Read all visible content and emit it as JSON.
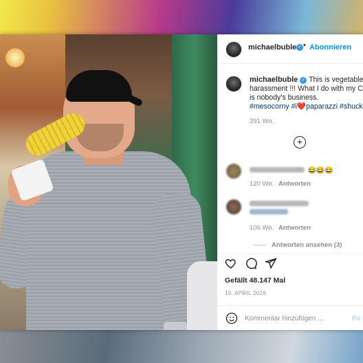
{
  "post": {
    "username": "michaelbuble",
    "follow_label": "Abonnieren",
    "caption_line1": "This is vegetable",
    "caption_line2": "harassment !!! What I do with my Co",
    "caption_line3": "is nobody's business.",
    "hashtag1": "#mesocorny",
    "hashtag2": "#i",
    "heart": "❤️",
    "hashtag3": "paparazzi",
    "hashtag4": "#shuck",
    "caption_age": "291 Wo.",
    "add_comments_icon": "plus-circle-icon",
    "comments": [
      {
        "emojis": "😂😂😂",
        "age": "120 Wo.",
        "reply": "Antworten"
      },
      {
        "age": "106 Wo.",
        "reply": "Antworten"
      }
    ],
    "view_replies": "Antworten ansehen (3)",
    "likes": "Gefällt 48.147 Mal",
    "date": "15. APRIL 2016",
    "comment_placeholder": "Kommentar hinzufügen ...",
    "post_label": "Po",
    "verified_mark": "✓",
    "plus_glyph": "+",
    "colors": {
      "link_blue": "#0095f6",
      "text": "#262626",
      "muted": "#8e8e8e",
      "heart_red": "#ed4956"
    }
  }
}
